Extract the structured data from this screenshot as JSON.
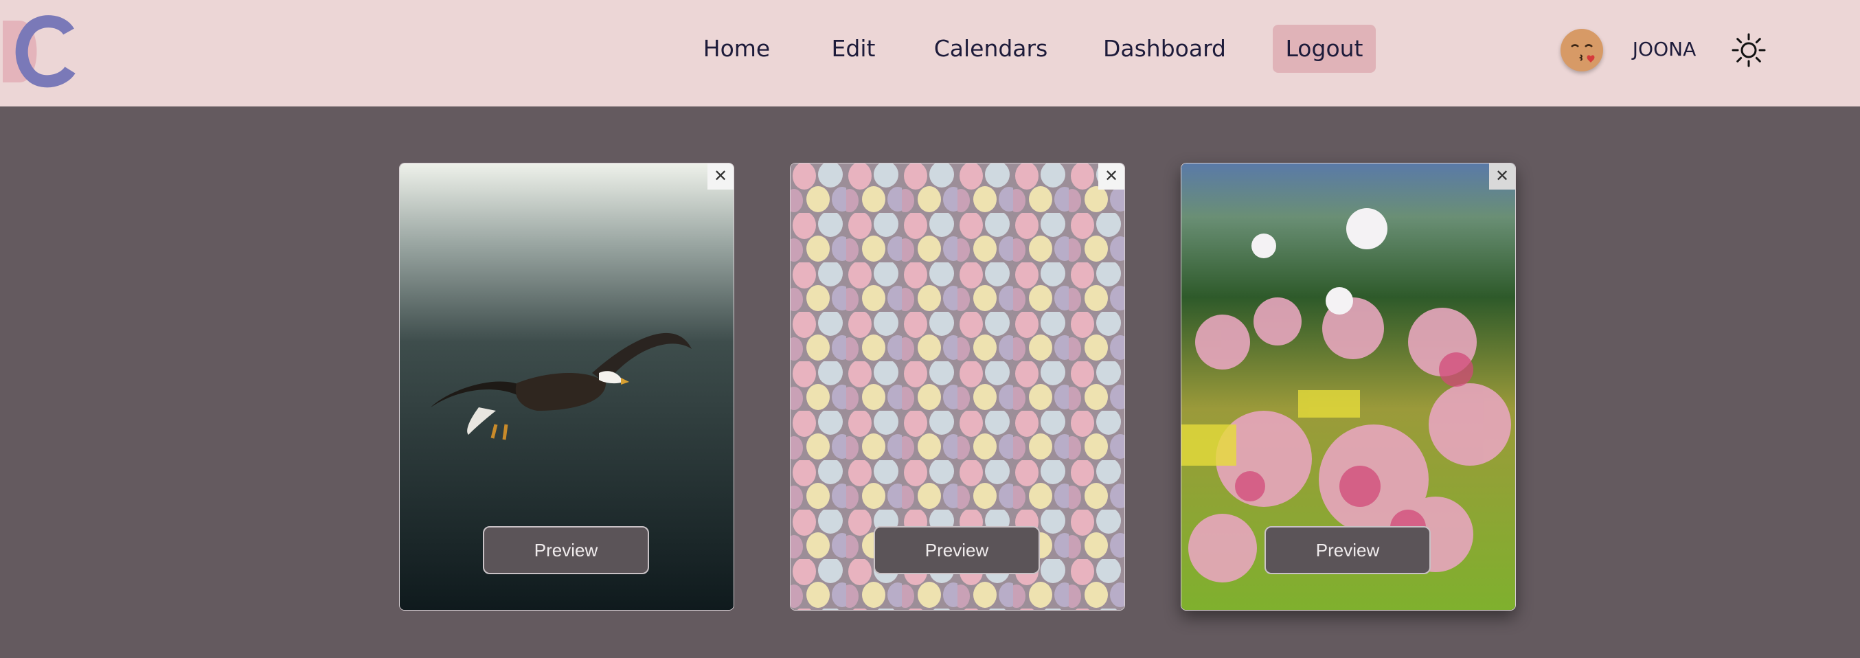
{
  "header": {
    "logo_icon": "dc-logo",
    "nav": {
      "home": "Home",
      "edit": "Edit",
      "calendars": "Calendars",
      "dashboard": "Dashboard",
      "logout": "Logout"
    },
    "avatar_icon": "kissing-face-emoji",
    "username": "JOONA",
    "theme_icon": "sun-icon"
  },
  "cards": [
    {
      "image": "bald eagle flying in dark misty sky",
      "close_icon": "close-icon",
      "preview_label": "Preview"
    },
    {
      "image": "pastel speckled mini eggs",
      "close_icon": "close-icon",
      "preview_label": "Preview"
    },
    {
      "image": "blooming pink trees in spring hillside",
      "close_icon": "close-icon",
      "preview_label": "Preview"
    }
  ],
  "colors": {
    "header_bg": "#ecd6d6",
    "page_bg": "#645a5f",
    "logout_bg": "#e0b3b8",
    "button_bg": "#5b5458",
    "nav_text": "#1d1b3a"
  }
}
